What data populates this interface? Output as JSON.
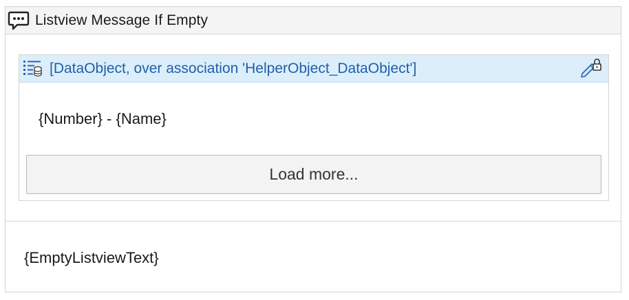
{
  "widget": {
    "title": "Listview Message If Empty",
    "icon": "speech-bubble-icon"
  },
  "listview": {
    "datasource_label": "[DataObject, over association 'HelperObject_DataObject']",
    "datasource_icon": "list-database-icon",
    "lock_icon": "edit-lock-icon",
    "item_template": "{Number} - {Name}",
    "load_more_label": "Load more..."
  },
  "empty_message": "{EmptyListviewText}",
  "colors": {
    "header_bg": "#f4f4f4",
    "datasource_bg": "#ddeefb",
    "datasource_text": "#1f5faa",
    "border": "#d4d4d4"
  }
}
